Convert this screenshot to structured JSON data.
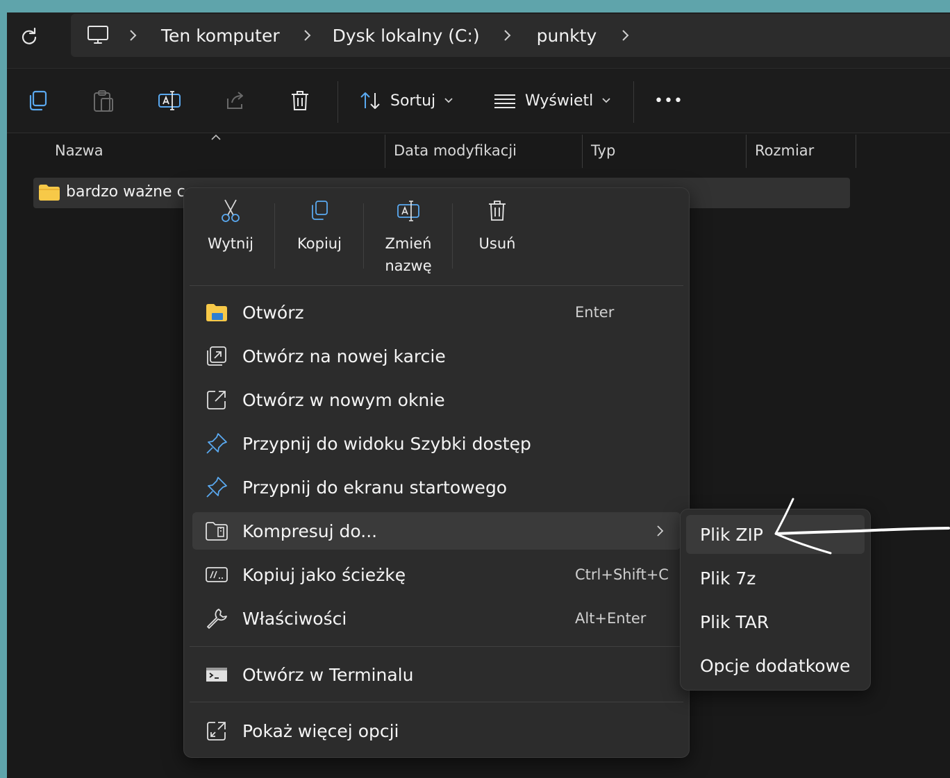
{
  "address_bar": {
    "breadcrumbs": [
      "Ten komputer",
      "Dysk lokalny (C:)",
      "punkty"
    ]
  },
  "toolbar": {
    "sort_label": "Sortuj",
    "view_label": "Wyświetl",
    "more_label": "•••"
  },
  "columns": {
    "name": "Nazwa",
    "modified": "Data modyfikacji",
    "type": "Typ",
    "size": "Rozmiar"
  },
  "files": [
    {
      "name": "bardzo ważne ce"
    }
  ],
  "context_menu": {
    "quick_actions": [
      {
        "label": "Wytnij",
        "icon": "scissors-icon"
      },
      {
        "label": "Kopiuj",
        "icon": "copy-icon"
      },
      {
        "label": "Zmień nazwę",
        "icon": "rename-icon"
      },
      {
        "label": "Usuń",
        "icon": "trash-icon"
      }
    ],
    "items": [
      {
        "label": "Otwórz",
        "shortcut": "Enter",
        "icon": "folder-open-icon"
      },
      {
        "label": "Otwórz na nowej karcie",
        "shortcut": "",
        "icon": "new-tab-icon"
      },
      {
        "label": "Otwórz w nowym oknie",
        "shortcut": "",
        "icon": "new-window-icon"
      },
      {
        "label": "Przypnij do widoku Szybki dostęp",
        "shortcut": "",
        "icon": "pin-icon"
      },
      {
        "label": "Przypnij do ekranu startowego",
        "shortcut": "",
        "icon": "pin-icon"
      },
      {
        "label": "Kompresuj do...",
        "shortcut": "",
        "icon": "compress-icon"
      },
      {
        "label": "Kopiuj jako ścieżkę",
        "shortcut": "Ctrl+Shift+C",
        "icon": "copy-path-icon"
      },
      {
        "label": "Właściwości",
        "shortcut": "Alt+Enter",
        "icon": "wrench-icon"
      },
      {
        "label": "Otwórz w Terminalu",
        "shortcut": "",
        "icon": "terminal-icon"
      },
      {
        "label": "Pokaż więcej opcji",
        "shortcut": "",
        "icon": "more-options-icon"
      }
    ]
  },
  "submenu": {
    "items": [
      "Plik ZIP",
      "Plik 7z",
      "Plik TAR",
      "Opcje dodatkowe"
    ]
  },
  "colors": {
    "frame": "#5fa4ab",
    "window_bg": "#191919",
    "menu_bg": "#2c2c2c",
    "folder_yellow": "#f7c948",
    "annotation_arrow": "#ffffff"
  }
}
